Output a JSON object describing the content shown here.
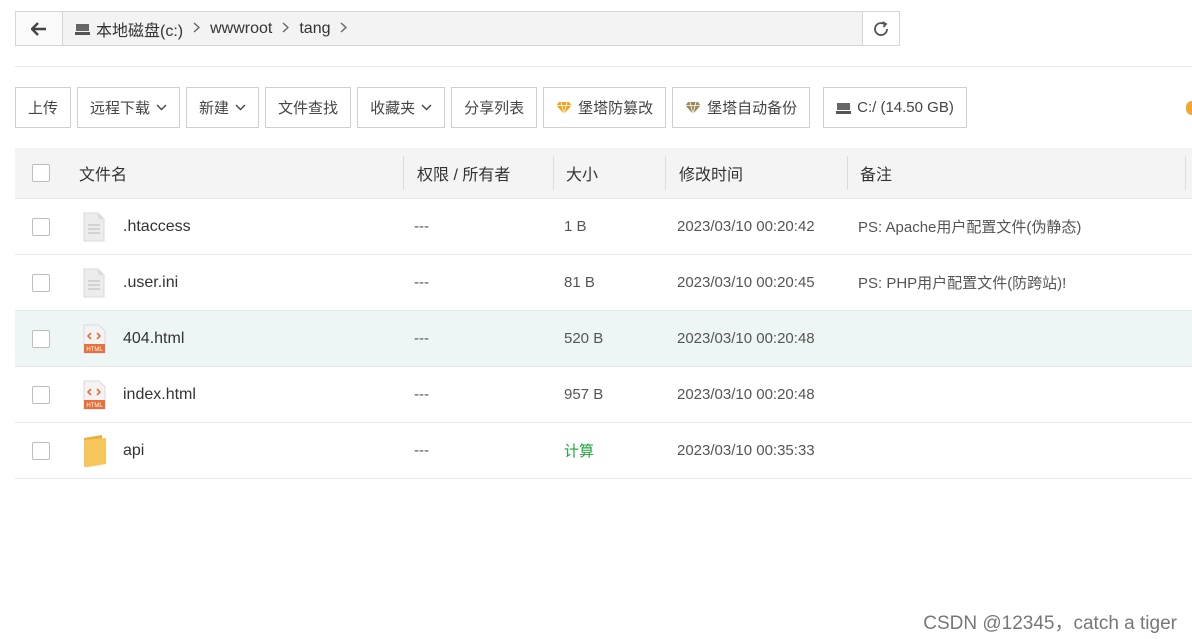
{
  "path_bar": {
    "crumbs": [
      "本地磁盘(c:)",
      "wwwroot",
      "tang"
    ],
    "separator": ">"
  },
  "toolbar": {
    "upload": "上传",
    "remote_download": "远程下载",
    "new": "新建",
    "file_search": "文件查找",
    "favorites": "收藏夹",
    "share_list": "分享列表",
    "tamper_proof": "堡塔防篡改",
    "auto_backup": "堡塔自动备份",
    "disk": "C:/ (14.50 GB)"
  },
  "table": {
    "headers": {
      "name": "文件名",
      "perm": "权限 / 所有者",
      "size": "大小",
      "mtime": "修改时间",
      "note": "备注"
    },
    "rows": [
      {
        "name": ".htaccess",
        "icon": "text-file-icon",
        "perm": "---",
        "size": "1 B",
        "mtime": "2023/03/10 00:20:42",
        "note": "PS: Apache用户配置文件(伪静态)"
      },
      {
        "name": ".user.ini",
        "icon": "text-file-icon",
        "perm": "---",
        "size": "81 B",
        "mtime": "2023/03/10 00:20:45",
        "note": "PS: PHP用户配置文件(防跨站)!"
      },
      {
        "name": "404.html",
        "icon": "html-file-icon",
        "perm": "---",
        "size": "520 B",
        "mtime": "2023/03/10 00:20:48",
        "note": ""
      },
      {
        "name": "index.html",
        "icon": "html-file-icon",
        "perm": "---",
        "size": "957 B",
        "mtime": "2023/03/10 00:20:48",
        "note": ""
      },
      {
        "name": "api",
        "icon": "folder-icon",
        "perm": "---",
        "size": "计算",
        "mtime": "2023/03/10 00:35:33",
        "note": ""
      }
    ]
  },
  "html_badge": "HTML",
  "watermark": "CSDN @12345，catch a tiger",
  "colors": {
    "accent_green": "#20a53a",
    "hover_row": "#eef6f5",
    "folder": "#f7c65a",
    "html_icon": "#e8703a"
  }
}
